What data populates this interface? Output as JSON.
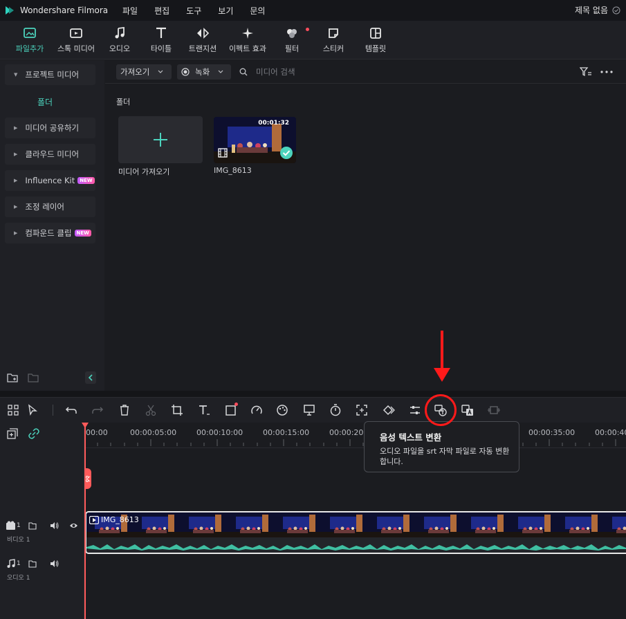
{
  "app": {
    "name": "Wondershare Filmora",
    "project_title": "제목 없음"
  },
  "menu": [
    "파일",
    "편집",
    "도구",
    "보기",
    "문의"
  ],
  "toolbar": {
    "items": [
      {
        "label": "파일추가",
        "icon": "import-media-icon",
        "active": true
      },
      {
        "label": "스톡 미디어",
        "icon": "stock-media-icon"
      },
      {
        "label": "오디오",
        "icon": "music-note-icon"
      },
      {
        "label": "타이틀",
        "icon": "title-T-icon"
      },
      {
        "label": "트랜지션",
        "icon": "transition-icon"
      },
      {
        "label": "이펙트 효과",
        "icon": "effects-sparkle-icon"
      },
      {
        "label": "필터",
        "icon": "filter-icon"
      },
      {
        "label": "스티커",
        "icon": "sticker-icon"
      },
      {
        "label": "템플릿",
        "icon": "template-icon"
      }
    ]
  },
  "sidebar": {
    "project_media": "프로젝트 미디어",
    "folder": "폴더",
    "items": [
      {
        "label": "미디어 공유하기"
      },
      {
        "label": "클라우드 미디어"
      },
      {
        "label": "Influence Kit",
        "badge": "NEW"
      },
      {
        "label": "조정 레이어"
      },
      {
        "label": "컴파운드 클립",
        "badge": "NEW"
      }
    ]
  },
  "media_toolbar": {
    "import_dropdown": "가져오기",
    "record_dropdown": "녹화",
    "search_placeholder": "미디어 검색"
  },
  "media": {
    "folder_label": "폴더",
    "import_tile_label": "미디어 가져오기",
    "clip": {
      "name": "IMG_8613",
      "duration": "00:01:32"
    }
  },
  "timeline": {
    "ticks": [
      "00:00",
      "00:00:05:00",
      "00:00:10:00",
      "00:00:15:00",
      "00:00:20:",
      "00:00:35:00",
      "00:00:40"
    ],
    "video_track": {
      "index": "1",
      "label": "비디오 1",
      "clip_name": "IMG_8613"
    },
    "audio_track": {
      "index": "1",
      "label": "오디오 1"
    }
  },
  "tooltip": {
    "title": "음성 텍스트 변환",
    "description": "오디오 파일을 srt 자막 파일로 자동 변환합니다."
  },
  "colors": {
    "accent": "#4cd3bd",
    "playhead": "#ff5a5a",
    "annotation": "#ff1a1a"
  }
}
